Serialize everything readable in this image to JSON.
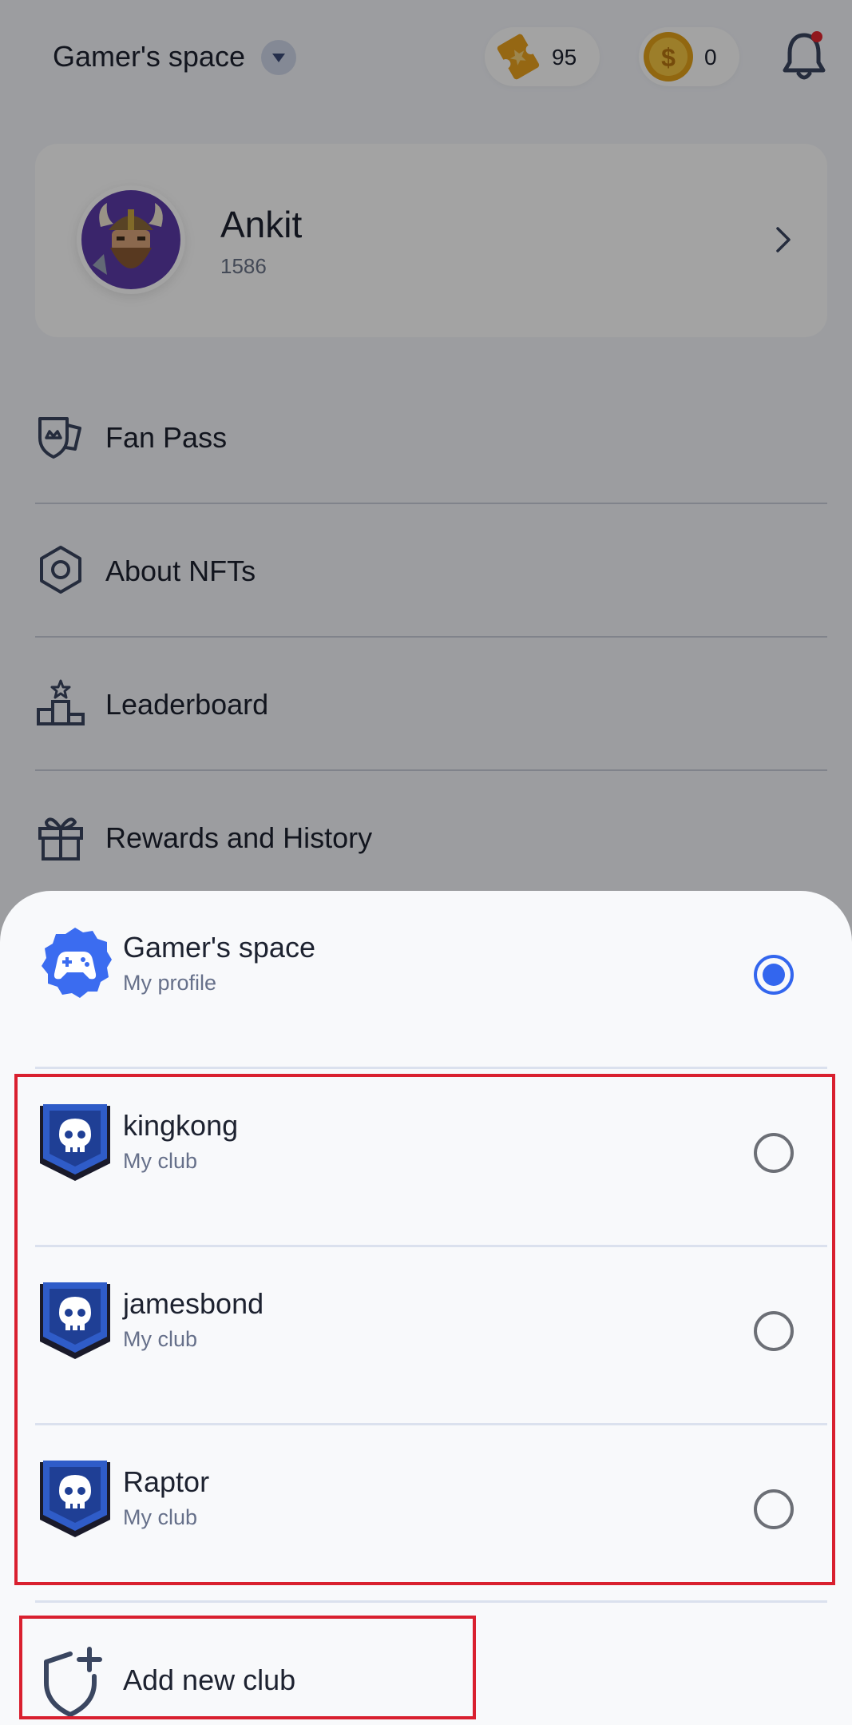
{
  "header": {
    "space_title": "Gamer's space",
    "tickets": "95",
    "coins": "0",
    "notification_dot": true
  },
  "profile": {
    "name": "Ankit",
    "points": "1586"
  },
  "menu": {
    "items": [
      {
        "label": "Fan Pass",
        "icon": "fan-pass-shield-icon"
      },
      {
        "label": "About NFTs",
        "icon": "hexagon-icon"
      },
      {
        "label": "Leaderboard",
        "icon": "podium-icon"
      },
      {
        "label": "Rewards and History",
        "icon": "gift-icon"
      }
    ]
  },
  "sheet": {
    "profile": {
      "title": "Gamer's space",
      "subtitle": "My profile",
      "selected": true
    },
    "clubs": [
      {
        "title": "kingkong",
        "subtitle": "My club",
        "selected": false
      },
      {
        "title": "jamesbond",
        "subtitle": "My club",
        "selected": false
      },
      {
        "title": "Raptor",
        "subtitle": "My club",
        "selected": false
      }
    ],
    "add_club_label": "Add new club"
  },
  "colors": {
    "accent": "#3366ee",
    "highlight": "#d9202f",
    "overlay": "rgba(0,0,0,0.36)"
  }
}
